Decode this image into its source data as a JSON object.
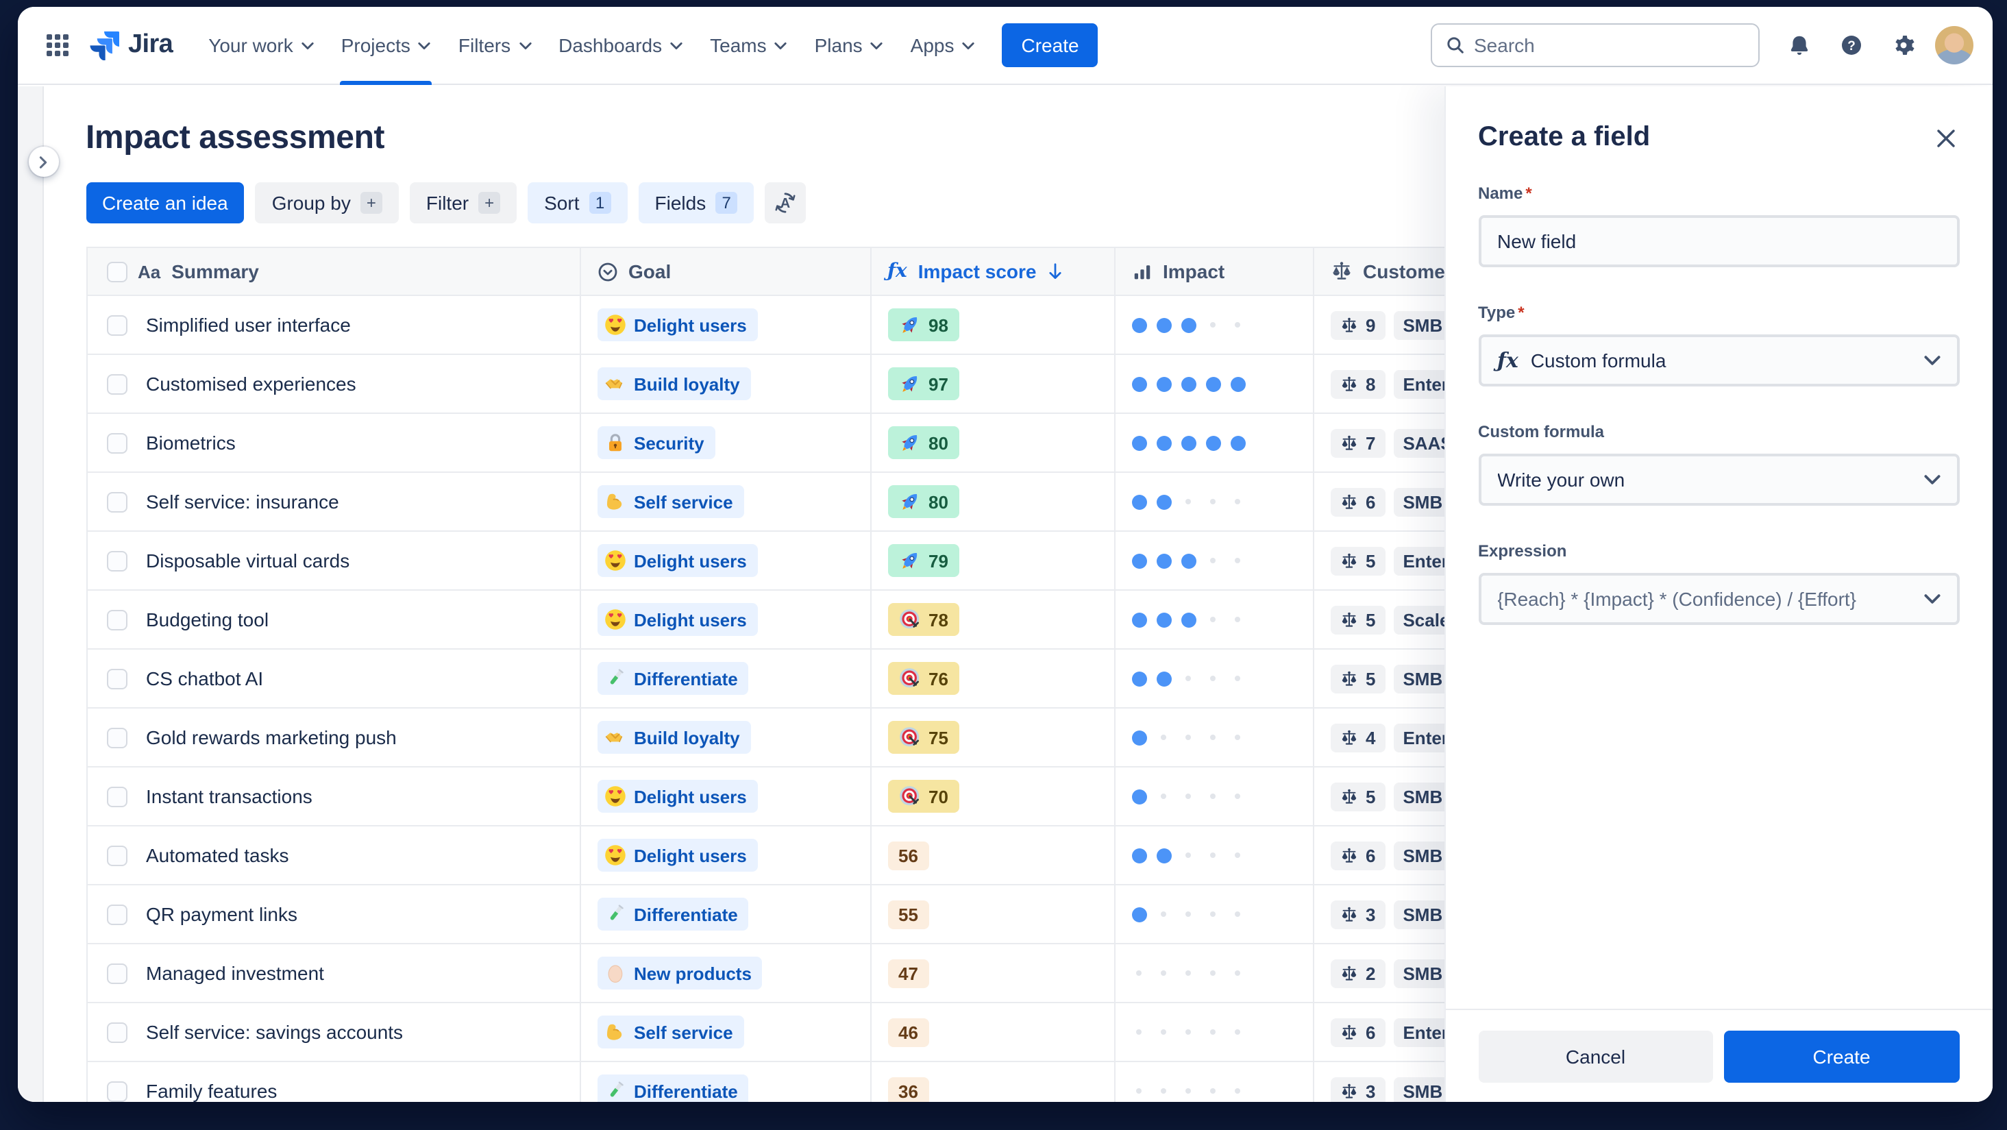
{
  "nav": {
    "logo_text": "Jira",
    "items": [
      "Your work",
      "Projects",
      "Filters",
      "Dashboards",
      "Teams",
      "Plans",
      "Apps"
    ],
    "active_item": "Projects",
    "create_button": "Create",
    "search": {
      "placeholder": "Search",
      "icon": "search-icon"
    },
    "right_icons": [
      "notifications-icon",
      "help-icon",
      "settings-icon"
    ],
    "avatar": "user-avatar"
  },
  "page": {
    "title": "Impact assessment",
    "toolbar": {
      "create_idea": "Create an idea",
      "group_by": {
        "label": "Group by",
        "badge": "+"
      },
      "filter": {
        "label": "Filter",
        "badge": "+"
      },
      "sort": {
        "label": "Sort",
        "badge": "1"
      },
      "fields": {
        "label": "Fields",
        "badge": "7"
      },
      "auto_sort_icon": "auto-sort-icon"
    }
  },
  "table": {
    "columns": [
      {
        "label": "Summary",
        "icon": "text-icon"
      },
      {
        "label": "Goal",
        "icon": "select-icon"
      },
      {
        "label": "Impact score",
        "icon": "formula-icon",
        "sort": "desc"
      },
      {
        "label": "Impact",
        "icon": "bar-chart-icon"
      },
      {
        "label": "Customer",
        "icon": "scale-icon"
      }
    ],
    "impact_dots_max": 5,
    "rows": [
      {
        "summary": "Simplified user interface",
        "goal": {
          "icon": "heart-eyes-icon",
          "label": "Delight users"
        },
        "score": {
          "value": "98",
          "tier": "green",
          "icon": "rocket-icon"
        },
        "impact": 3,
        "customer": {
          "count": "9",
          "segment": "SMB"
        }
      },
      {
        "summary": "Customised experiences",
        "goal": {
          "icon": "handshake-icon",
          "label": "Build loyalty"
        },
        "score": {
          "value": "97",
          "tier": "green",
          "icon": "rocket-icon"
        },
        "impact": 5,
        "customer": {
          "count": "8",
          "segment": "Enter"
        }
      },
      {
        "summary": "Biometrics",
        "goal": {
          "icon": "lock-icon",
          "label": "Security"
        },
        "score": {
          "value": "80",
          "tier": "green",
          "icon": "rocket-icon"
        },
        "impact": 5,
        "customer": {
          "count": "7",
          "segment": "SAAS"
        }
      },
      {
        "summary": "Self service: insurance",
        "goal": {
          "icon": "muscle-icon",
          "label": "Self service"
        },
        "score": {
          "value": "80",
          "tier": "green",
          "icon": "rocket-icon"
        },
        "impact": 2,
        "customer": {
          "count": "6",
          "segment": "SMB"
        }
      },
      {
        "summary": "Disposable virtual cards",
        "goal": {
          "icon": "heart-eyes-icon",
          "label": "Delight users"
        },
        "score": {
          "value": "79",
          "tier": "green",
          "icon": "rocket-icon"
        },
        "impact": 3,
        "customer": {
          "count": "5",
          "segment": "Enter"
        }
      },
      {
        "summary": "Budgeting tool",
        "goal": {
          "icon": "heart-eyes-icon",
          "label": "Delight users"
        },
        "score": {
          "value": "78",
          "tier": "yellow",
          "icon": "target-icon"
        },
        "impact": 3,
        "customer": {
          "count": "5",
          "segment": "Scale"
        }
      },
      {
        "summary": "CS chatbot AI",
        "goal": {
          "icon": "test-tube-icon",
          "label": "Differentiate"
        },
        "score": {
          "value": "76",
          "tier": "yellow",
          "icon": "target-icon"
        },
        "impact": 2,
        "customer": {
          "count": "5",
          "segment": "SMB"
        }
      },
      {
        "summary": "Gold rewards marketing push",
        "goal": {
          "icon": "handshake-icon",
          "label": "Build loyalty"
        },
        "score": {
          "value": "75",
          "tier": "yellow",
          "icon": "target-icon"
        },
        "impact": 1,
        "customer": {
          "count": "4",
          "segment": "Enter"
        }
      },
      {
        "summary": "Instant transactions",
        "goal": {
          "icon": "heart-eyes-icon",
          "label": "Delight users"
        },
        "score": {
          "value": "70",
          "tier": "yellow",
          "icon": "target-icon"
        },
        "impact": 1,
        "customer": {
          "count": "5",
          "segment": "SMB"
        }
      },
      {
        "summary": "Automated tasks",
        "goal": {
          "icon": "heart-eyes-icon",
          "label": "Delight users"
        },
        "score": {
          "value": "56",
          "tier": "peach",
          "icon": null
        },
        "impact": 2,
        "customer": {
          "count": "6",
          "segment": "SMB"
        }
      },
      {
        "summary": "QR payment links",
        "goal": {
          "icon": "test-tube-icon",
          "label": "Differentiate"
        },
        "score": {
          "value": "55",
          "tier": "peach",
          "icon": null
        },
        "impact": 1,
        "customer": {
          "count": "3",
          "segment": "SMB"
        }
      },
      {
        "summary": "Managed investment",
        "goal": {
          "icon": "egg-icon",
          "label": "New products"
        },
        "score": {
          "value": "47",
          "tier": "peach",
          "icon": null
        },
        "impact": 0,
        "customer": {
          "count": "2",
          "segment": "SMB"
        }
      },
      {
        "summary": "Self service: savings accounts",
        "goal": {
          "icon": "muscle-icon",
          "label": "Self service"
        },
        "score": {
          "value": "46",
          "tier": "peach",
          "icon": null
        },
        "impact": 0,
        "customer": {
          "count": "6",
          "segment": "Enter"
        }
      },
      {
        "summary": "Family features",
        "goal": {
          "icon": "test-tube-icon",
          "label": "Differentiate"
        },
        "score": {
          "value": "36",
          "tier": "peach",
          "icon": null
        },
        "impact": 0,
        "customer": {
          "count": "3",
          "segment": "SMB"
        }
      }
    ]
  },
  "panel": {
    "title": "Create a field",
    "close_icon": "close-icon",
    "fields": {
      "name": {
        "label": "Name",
        "required": "*",
        "value": "New field"
      },
      "type": {
        "label": "Type",
        "required": "*",
        "value": "Custom formula",
        "icon": "formula-icon"
      },
      "custom_formula": {
        "label": "Custom formula",
        "value": "Write your own"
      },
      "expression": {
        "label": "Expression",
        "value": "{Reach} * {Impact} * (Confidence) / {Effort}"
      }
    },
    "footer": {
      "cancel": "Cancel",
      "create": "Create"
    }
  },
  "colors": {
    "accent_blue": "#0C66E4",
    "sorted_header_blue": "#1868DB",
    "goal_chip_bg": "#E9F2FF",
    "score_green_bg": "#BCF2DA",
    "score_yellow_bg": "#F6E5A1",
    "score_peach_bg": "#FCEEDF",
    "impact_dot_blue": "#4C94F7",
    "frame_bg": "#0D1A38"
  }
}
